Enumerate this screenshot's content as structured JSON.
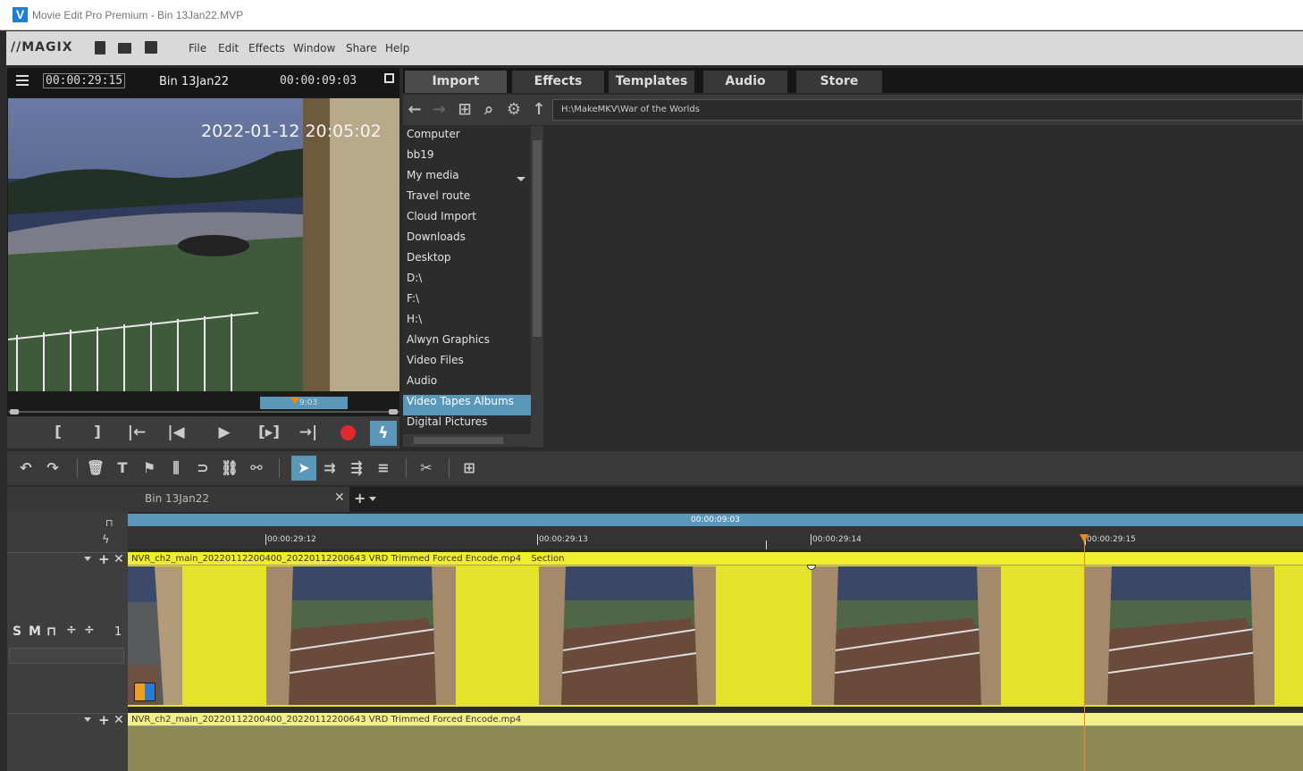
{
  "window": {
    "title": "Movie Edit Pro Premium - Bin 13Jan22.MVP"
  },
  "menubar": {
    "brand": "//MAGIX",
    "items": [
      "File",
      "Edit",
      "Effects",
      "Window",
      "Share",
      "Help"
    ]
  },
  "preview": {
    "timecode_left": "00:00:29:15",
    "bin_name": "Bin 13Jan22",
    "timecode_right": "00:00:09:03",
    "video_timestamp": "2022-01-12 20:05:02",
    "scrub_label": "9:03"
  },
  "mediapool": {
    "tabs": [
      "Import",
      "Effects",
      "Templates",
      "Audio",
      "Store"
    ],
    "active_tab": "Import",
    "path": "H:\\MakeMKV\\War of the Worlds",
    "folders": [
      "Computer",
      "bb19",
      "My media",
      "Travel route",
      "Cloud Import",
      "Downloads",
      "Desktop",
      "D:\\",
      "F:\\",
      "H:\\",
      "Alwyn Graphics",
      "Video Files",
      "Audio",
      "Video Tapes Albums",
      "Digital Pictures"
    ],
    "selected_folder": "Video Tapes Albums"
  },
  "timeline": {
    "tab_name": "Bin 13Jan22",
    "ruler_top": "00:00:09:03",
    "ruler_ticks": [
      "00:00:29:12",
      "00:00:29:13",
      "00:00:29:14",
      "00:00:29:15"
    ],
    "track1": {
      "number": "1",
      "clip_name": "NVR_ch2_main_20220112200400_20220112200643 VRD Trimmed Forced Encode.mp4",
      "section": "Section"
    },
    "track2": {
      "clip_name": "NVR_ch2_main_20220112200400_20220112200643 VRD Trimmed Forced Encode.mp4"
    }
  },
  "colors": {
    "accent": "#5a97b8",
    "clip_yellow": "#e4e22c",
    "playhead": "#e88b1a",
    "record": "#e0282e"
  }
}
